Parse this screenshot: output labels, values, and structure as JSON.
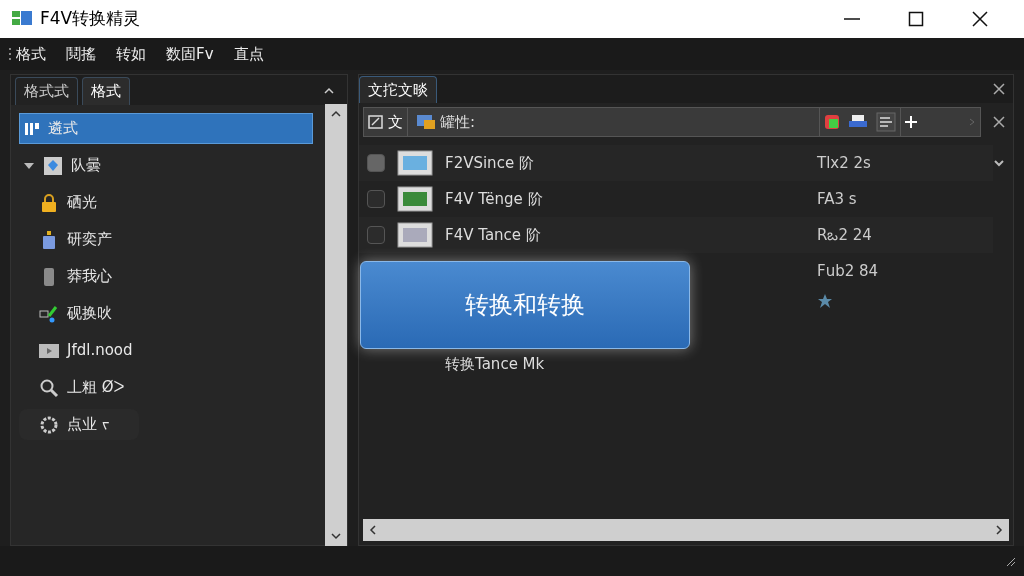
{
  "window": {
    "title": "F4V转换精灵"
  },
  "menu": [
    "格式",
    "鬩搖",
    "转如",
    "数固Fv",
    "直点"
  ],
  "left_tabs": [
    {
      "label": "格式式",
      "selected": false
    },
    {
      "label": "格式",
      "selected": true
    }
  ],
  "sidebar": {
    "items": [
      {
        "label": "遴式",
        "selected": true
      },
      {
        "label": "队曇",
        "selected": false,
        "expanded": true,
        "children": [
          {
            "label": "硒光",
            "selected": false
          },
          {
            "label": "研奕产",
            "selected": false
          },
          {
            "label": "莽我心",
            "selected": false
          },
          {
            "label": "砚换吙",
            "selected": false
          },
          {
            "label": "Jfdl.nood",
            "selected": false
          },
          {
            "label": "丄粗 Øᐳ",
            "selected": false
          },
          {
            "label": "点业 ᠵ",
            "selected": false
          }
        ]
      }
    ]
  },
  "right_tab": {
    "label": "文拕文晱",
    "selected": true
  },
  "toolbar": {
    "left_button": "文",
    "location_label": "罐性:"
  },
  "files": [
    {
      "kind": "checkbox",
      "checked": true,
      "name": "F2VSince 阶",
      "detail": "Tlx2 2s"
    },
    {
      "kind": "checkbox",
      "checked": false,
      "name": "F4V Tënge 阶",
      "detail": "FA3 s"
    },
    {
      "kind": "checkbox",
      "checked": false,
      "name": "F4V Tance 阶",
      "detail": "Rఒ2 24"
    },
    {
      "kind": "plain",
      "detail": "Fսb2 84"
    },
    {
      "kind": "starred",
      "name": "转换Tance Mk"
    }
  ],
  "overlay_button": "转换和转换"
}
